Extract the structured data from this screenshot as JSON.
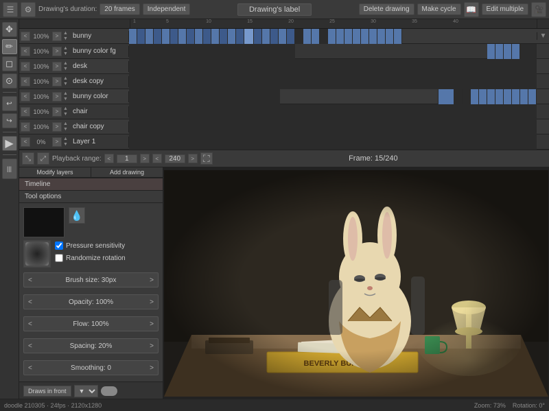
{
  "topbar": {
    "drawing_duration_label": "Drawing's duration:",
    "frames_btn": "20 frames",
    "independent_btn": "Independent",
    "drawing_label_btn": "Drawing's label",
    "delete_drawing_btn": "Delete drawing",
    "make_cycle_btn": "Make cycle",
    "edit_multiple_btn": "Edit multiple"
  },
  "layers": {
    "modify_btn": "Modify layers",
    "add_btn": "Add drawing",
    "timeline_tab": "Timeline",
    "tool_options_tab": "Tool options",
    "items": [
      {
        "pct": "100%",
        "name": "bunny"
      },
      {
        "pct": "100%",
        "name": "bunny color fg"
      },
      {
        "pct": "100%",
        "name": "desk"
      },
      {
        "pct": "100%",
        "name": "desk copy"
      },
      {
        "pct": "100%",
        "name": "bunny color"
      },
      {
        "pct": "100%",
        "name": "chair"
      },
      {
        "pct": "100%",
        "name": "chair copy"
      },
      {
        "pct": "0%",
        "name": "Layer 1"
      }
    ]
  },
  "playback": {
    "range_label": "Playback range:",
    "start": "1",
    "end": "240",
    "frame_info": "Frame: 15/240"
  },
  "tool_options": {
    "pressure_sensitivity_label": "Pressure sensitivity",
    "randomize_rotation_label": "Randomize rotation",
    "brush_size_label": "Brush size: 30px",
    "opacity_label": "Opacity: 100%",
    "flow_label": "Flow: 100%",
    "spacing_label": "Spacing: 20%",
    "smoothing_label": "Smoothing: 0",
    "draws_in_front_label": "Draws in front"
  },
  "footer": {
    "info": "doodle 210305 · 24fps · 2120x1280",
    "zoom": "Zoom: 73%",
    "rotation": "Rotation: 0°"
  },
  "canvas": {
    "alt": "Beverly Bunny P.I. animation frame"
  }
}
